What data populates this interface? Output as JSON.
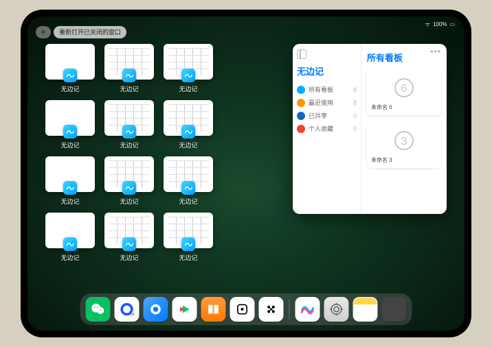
{
  "statusbar": {
    "battery": "100%"
  },
  "toolbar": {
    "plus": "+",
    "reopen": "重新打开已关闭的窗口"
  },
  "app_label": "无边记",
  "windows": [
    {
      "label": "无边记",
      "style": "blank"
    },
    {
      "label": "无边记",
      "style": "cal"
    },
    {
      "label": "无边记",
      "style": "cal"
    },
    {
      "label": "无边记",
      "style": "blank"
    },
    {
      "label": "无边记",
      "style": "cal"
    },
    {
      "label": "无边记",
      "style": "cal"
    },
    {
      "label": "无边记",
      "style": "blank"
    },
    {
      "label": "无边记",
      "style": "cal"
    },
    {
      "label": "无边记",
      "style": "cal"
    },
    {
      "label": "无边记",
      "style": "blank"
    },
    {
      "label": "无边记",
      "style": "cal"
    },
    {
      "label": "无边记",
      "style": "cal"
    }
  ],
  "stage": {
    "ellipsis": "•••",
    "sidebar_title": "无边记",
    "right_title": "所有看板",
    "categories": [
      {
        "name": "所有看板",
        "count": 8,
        "color": "blue"
      },
      {
        "name": "最近使用",
        "count": 8,
        "color": "orange"
      },
      {
        "name": "已共享",
        "count": 0,
        "color": "navy"
      },
      {
        "name": "个人收藏",
        "count": 0,
        "color": "red"
      }
    ],
    "boards": [
      {
        "name": "未命名 6",
        "date": "",
        "glyph": "6"
      },
      {
        "name": "未命名 3",
        "date": "",
        "glyph": "3"
      }
    ]
  },
  "dock": {
    "items": [
      {
        "name": "wechat"
      },
      {
        "name": "quark"
      },
      {
        "name": "qq-browser"
      },
      {
        "name": "iqiyi"
      },
      {
        "name": "books"
      },
      {
        "name": "app-1"
      },
      {
        "name": "app-2"
      },
      {
        "name": "freeform"
      },
      {
        "name": "settings"
      },
      {
        "name": "notes"
      },
      {
        "name": "app-library"
      }
    ]
  }
}
